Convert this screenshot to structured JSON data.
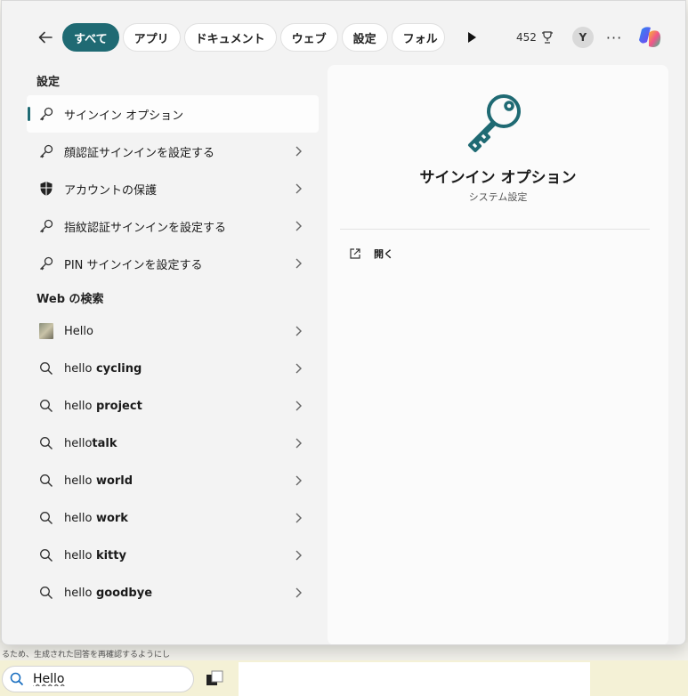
{
  "tabs": [
    {
      "label": "すべて",
      "active": true
    },
    {
      "label": "アプリ",
      "active": false
    },
    {
      "label": "ドキュメント",
      "active": false
    },
    {
      "label": "ウェブ",
      "active": false
    },
    {
      "label": "設定",
      "active": false
    },
    {
      "label": "フォル",
      "active": false
    }
  ],
  "header": {
    "points": "452",
    "avatar_initial": "Y"
  },
  "settings_section": {
    "heading": "設定",
    "items": [
      {
        "label": "サインイン オプション",
        "icon": "key-icon",
        "selected": true
      },
      {
        "label": "顔認証サインインを設定する",
        "icon": "key-icon"
      },
      {
        "label": "アカウントの保護",
        "icon": "shield-icon"
      },
      {
        "label": "指紋認証サインインを設定する",
        "icon": "key-icon"
      },
      {
        "label": "PIN サインインを設定する",
        "icon": "key-icon"
      }
    ]
  },
  "web_section": {
    "heading": "Web の検索",
    "items": [
      {
        "prefix": "Hello",
        "suffix": "",
        "icon": "image-thumbnail"
      },
      {
        "prefix": "hello",
        "suffix": " cycling",
        "icon": "search-icon"
      },
      {
        "prefix": "hello",
        "suffix": " project",
        "icon": "search-icon"
      },
      {
        "prefix": "hello",
        "suffix": "talk",
        "icon": "search-icon"
      },
      {
        "prefix": "hello",
        "suffix": " world",
        "icon": "search-icon"
      },
      {
        "prefix": "hello",
        "suffix": " work",
        "icon": "search-icon"
      },
      {
        "prefix": "hello",
        "suffix": " kitty",
        "icon": "search-icon"
      },
      {
        "prefix": "hello",
        "suffix": " goodbye",
        "icon": "search-icon"
      }
    ]
  },
  "detail": {
    "title": "サインイン オプション",
    "subtitle": "システム設定",
    "open_label": "開く"
  },
  "background_text": "るため、生成された回答を再確認するようにし",
  "taskbar": {
    "search_value": "Hello"
  },
  "colors": {
    "accent": "#1f6a73",
    "panel_bg": "#f3f3f3"
  }
}
